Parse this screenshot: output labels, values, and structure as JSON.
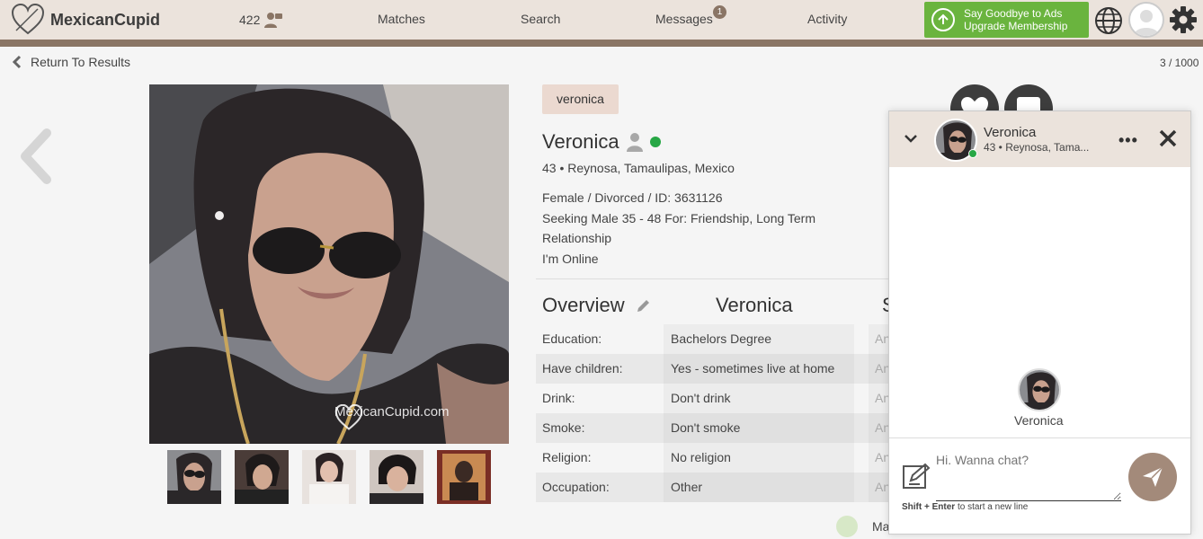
{
  "header": {
    "logo_text": "MexicanCupid",
    "count": "422",
    "nav": {
      "matches": "Matches",
      "search": "Search",
      "messages": "Messages",
      "activity": "Activity"
    },
    "messages_badge": "1",
    "upgrade_line1": "Say Goodbye to Ads",
    "upgrade_line2": "Upgrade Membership",
    "brand_color": "#8a7565",
    "upgrade_color": "#6ab43e"
  },
  "subbar": {
    "return_label": "Return To Results",
    "pager": "3 / 1000"
  },
  "photo": {
    "watermark": "MexicanCupid.com",
    "thumb_count": 5
  },
  "profile": {
    "tag": "veronica",
    "name": "Veronica",
    "location": "43 • Reynosa, Tamaulipas, Mexico",
    "line1": "Female / Divorced / ID: 3631126",
    "line2": "Seeking Male 35 - 48 For: Friendship, Long Term Relationship",
    "line3": "I'm Online"
  },
  "overview": {
    "title": "Overview",
    "col_name": "Veronica",
    "col_second": "S",
    "rows": [
      {
        "label": "Education:",
        "value": "Bachelors Degree",
        "other": "An"
      },
      {
        "label": "Have children:",
        "value": "Yes - sometimes live at home",
        "other": "An"
      },
      {
        "label": "Drink:",
        "value": "Don't drink",
        "other": "An"
      },
      {
        "label": "Smoke:",
        "value": "Don't smoke",
        "other": "An"
      },
      {
        "label": "Religion:",
        "value": "No religion",
        "other": "An"
      },
      {
        "label": "Occupation:",
        "value": "Other",
        "other": "An"
      }
    ]
  },
  "bottom": {
    "partial": "Ma"
  },
  "chat": {
    "name": "Veronica",
    "sub": "43 • Reynosa, Tama...",
    "mid_name": "Veronica",
    "input_placeholder": "Hi. Wanna chat?",
    "hint_key": "Shift + Enter",
    "hint_text": " to start a new line"
  }
}
